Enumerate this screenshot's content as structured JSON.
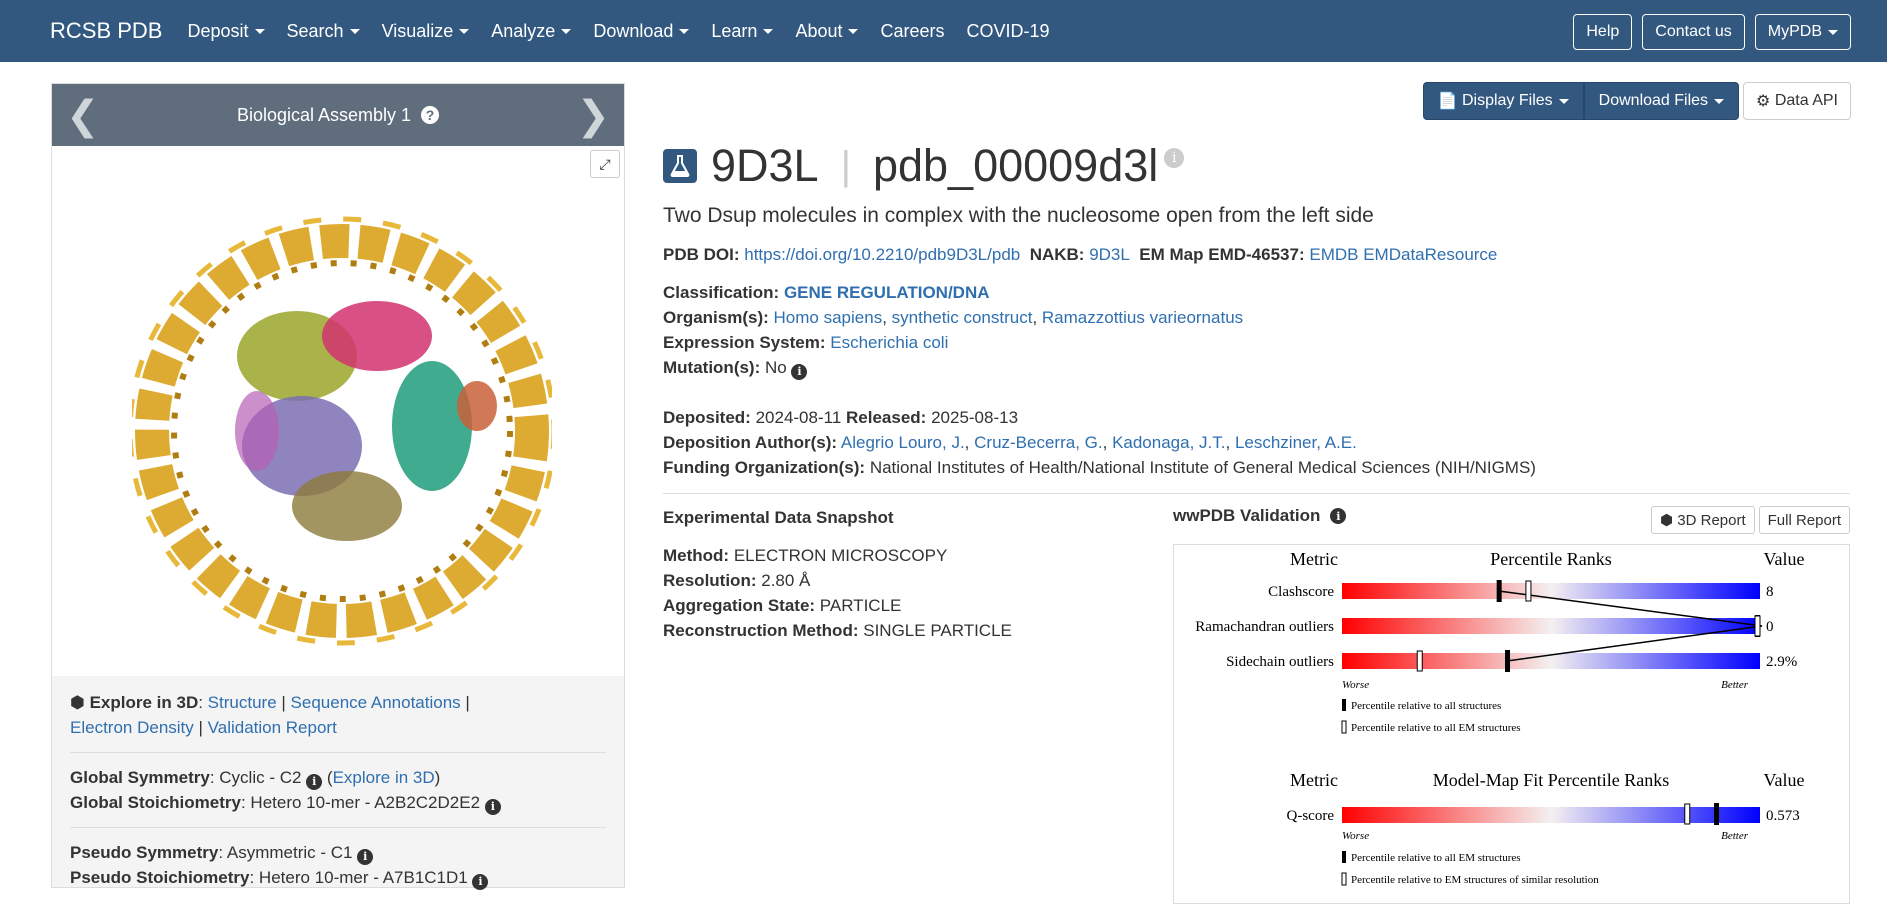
{
  "nav": {
    "brand": "RCSB PDB",
    "items": [
      "Deposit",
      "Search",
      "Visualize",
      "Analyze",
      "Download",
      "Learn",
      "About",
      "Careers",
      "COVID-19"
    ],
    "help": "Help",
    "contact": "Contact us",
    "mypdb": "MyPDB"
  },
  "assembly": {
    "title": "Biological Assembly 1",
    "help_glyph": "?"
  },
  "explore": {
    "label": "Explore in 3D",
    "structure": "Structure",
    "sequence": "Sequence Annotations",
    "density": "Electron Density",
    "validation": "Validation Report",
    "global_symmetry_label": "Global Symmetry",
    "global_symmetry_value": ": Cyclic - C2",
    "explore_link": "Explore in 3D",
    "global_stoich_label": "Global Stoichiometry",
    "global_stoich_value": ": Hetero 10-mer - A2B2C2D2E2",
    "pseudo_symmetry_label": "Pseudo Symmetry",
    "pseudo_symmetry_value": ": Asymmetric - C1",
    "pseudo_stoich_label": "Pseudo Stoichiometry",
    "pseudo_stoich_value": ": Hetero 10-mer - A7B1C1D1"
  },
  "toolbar": {
    "display_files": "Display Files",
    "download_files": "Download Files",
    "data_api": "Data API"
  },
  "entry": {
    "id": "9D3L",
    "ext_id": "pdb_00009d3l",
    "title": "Two Dsup molecules in complex with the nucleosome open from the left side",
    "doi_label": "PDB DOI:",
    "doi": "https://doi.org/10.2210/pdb9D3L/pdb",
    "nakb_label": "NAKB:",
    "nakb": "9D3L",
    "emmap_label": "EM Map EMD-46537:",
    "emdb": "EMDB",
    "emdataresource": "EMDataResource",
    "classification_label": "Classification:",
    "classification": "GENE REGULATION/DNA",
    "organism_label": "Organism(s):",
    "organisms": [
      "Homo sapiens",
      "synthetic construct",
      "Ramazzottius varieornatus"
    ],
    "expression_label": "Expression System:",
    "expression": "Escherichia coli",
    "mutation_label": "Mutation(s):",
    "mutation": "No",
    "deposited_label": "Deposited:",
    "deposited": "2024-08-11",
    "released_label": "Released:",
    "released": "2025-08-13",
    "authors_label": "Deposition Author(s):",
    "authors": [
      "Alegrio Louro, J.",
      "Cruz-Becerra, G.",
      "Kadonaga, J.T.",
      "Leschziner, A.E."
    ],
    "funding_label": "Funding Organization(s):",
    "funding": "National Institutes of Health/National Institute of General Medical Sciences (NIH/NIGMS)"
  },
  "snapshot": {
    "title": "Experimental Data Snapshot",
    "method_label": "Method:",
    "method": "ELECTRON MICROSCOPY",
    "resolution_label": "Resolution:",
    "resolution": "2.80 Å",
    "aggregation_label": "Aggregation State:",
    "aggregation": "PARTICLE",
    "reconstruction_label": "Reconstruction Method:",
    "reconstruction": "SINGLE PARTICLE"
  },
  "validation": {
    "title": "wwPDB Validation",
    "report3d": "3D Report",
    "full_report": "Full Report",
    "header_metric": "Metric",
    "header_ranks": "Percentile Ranks",
    "header_value": "Value",
    "metrics": [
      {
        "name": "Clashscore",
        "value": "8",
        "all_pct": 37,
        "em_pct": 44
      },
      {
        "name": "Ramachandran outliers",
        "value": "0",
        "all_pct": 100,
        "em_pct": 100
      },
      {
        "name": "Sidechain outliers",
        "value": "2.9%",
        "all_pct": 39,
        "em_pct": 18
      }
    ],
    "worse": "Worse",
    "better": "Better",
    "legend_all": "Percentile relative to all structures",
    "legend_em": "Percentile relative to all EM structures",
    "fit_header_metric": "Metric",
    "fit_header_ranks": "Model-Map Fit Percentile Ranks",
    "fit_header_value": "Value",
    "fit_metric": {
      "name": "Q-score",
      "value": "0.573",
      "em_pct": 89,
      "res_pct": 82
    },
    "fit_legend_em": "Percentile relative to all EM structures",
    "fit_legend_res": "Percentile relative to EM structures of similar resolution"
  },
  "colors": {
    "nav_bg": "#325880",
    "link": "#2f6fb0",
    "dna": "#d9a21b"
  }
}
